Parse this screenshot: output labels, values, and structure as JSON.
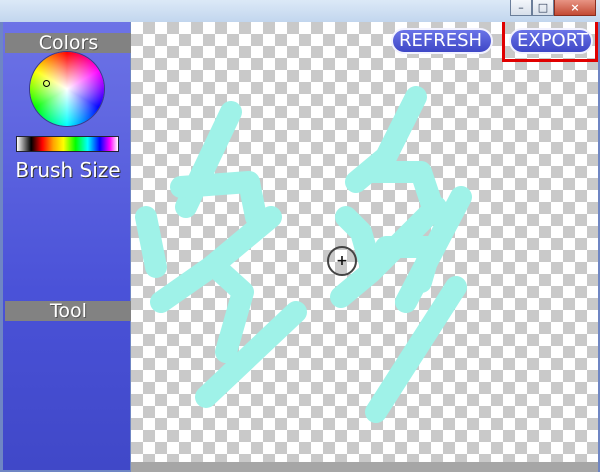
{
  "sidebar": {
    "colors_header": "Colors",
    "brush_size_label": "Brush Size",
    "tool_header": "Tool"
  },
  "toolbar": {
    "refresh_label": "REFRESH",
    "export_label": "EXPORT"
  },
  "window_controls": {
    "minimize": "–",
    "maximize": "□",
    "close": "×"
  },
  "colors": {
    "stroke": "#9ff2e8",
    "highlight": "#e00000",
    "button_fill": "#4f59d6"
  }
}
